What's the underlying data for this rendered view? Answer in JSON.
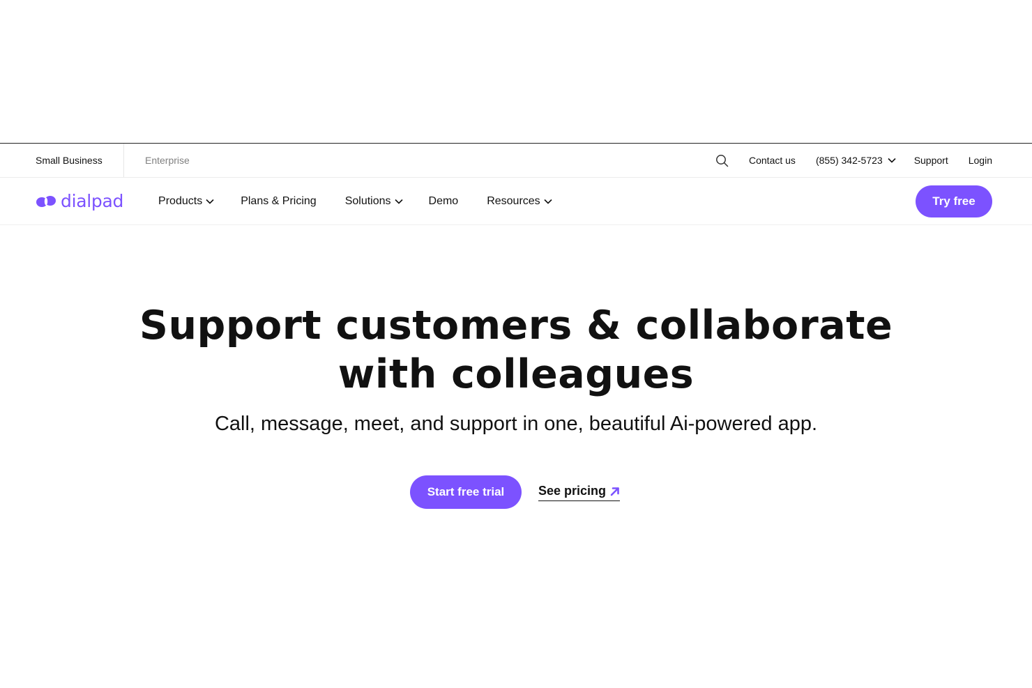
{
  "utility_bar": {
    "segments": [
      {
        "label": "Small Business",
        "active": true
      },
      {
        "label": "Enterprise",
        "active": false
      }
    ],
    "search_icon": "search-icon",
    "contact_label": "Contact us",
    "phone_label": "(855) 342-5723",
    "support_label": "Support",
    "login_label": "Login"
  },
  "nav": {
    "logo_text": "dialpad",
    "items": [
      {
        "label": "Products",
        "has_dropdown": true
      },
      {
        "label": "Plans & Pricing",
        "has_dropdown": false
      },
      {
        "label": "Solutions",
        "has_dropdown": true
      },
      {
        "label": "Demo",
        "has_dropdown": false
      },
      {
        "label": "Resources",
        "has_dropdown": true
      }
    ],
    "cta_label": "Try free"
  },
  "hero": {
    "title_line1": "Support customers & collaborate",
    "title_line2": "with colleagues",
    "subtitle": "Call, message, meet, and support in one, beautiful Ai-powered app.",
    "primary_cta": "Start free trial",
    "secondary_cta": "See pricing"
  },
  "colors": {
    "brand": "#7c52ff",
    "text": "#111111",
    "muted": "#808080"
  }
}
